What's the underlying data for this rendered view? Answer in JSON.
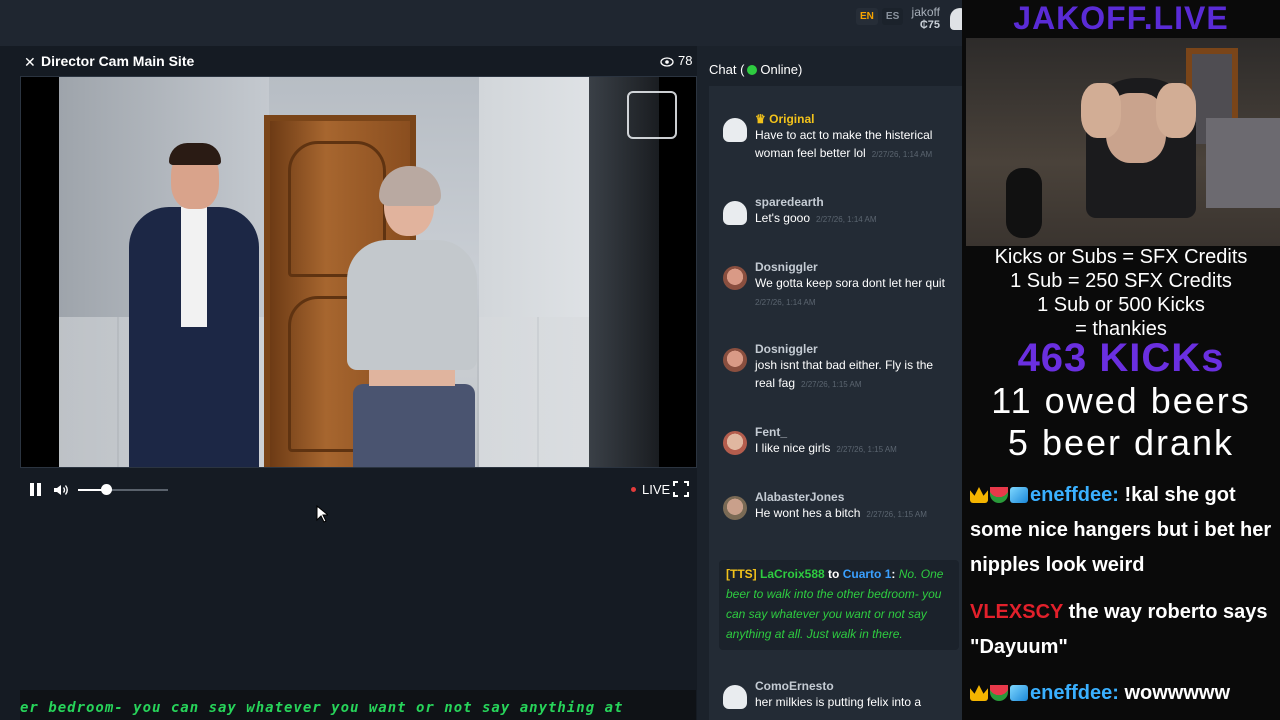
{
  "topbar": {
    "languages": [
      {
        "code": "EN",
        "active": true
      },
      {
        "code": "ES",
        "active": false
      }
    ],
    "user_name": "jakoff",
    "user_credits": "₵75"
  },
  "video": {
    "title": "Director Cam Main Site",
    "viewer_count": "78",
    "live_label": "LIVE",
    "volume_level": 0.3
  },
  "ticker_text": "er bedroom- you can say whatever you want or not say anything at",
  "chat": {
    "header_prefix": "Chat (",
    "status": "Online",
    "header_suffix": ")",
    "messages": [
      {
        "user": "Original",
        "text": "Have to act to make the histerical woman feel better lol",
        "time": "2/27/26, 1:14 AM",
        "crown": true
      },
      {
        "user": "sparedearth",
        "text": "Let's gooo",
        "time": "2/27/26, 1:14 AM"
      },
      {
        "user": "Dosniggler",
        "text": "We gotta keep sora dont let her quit",
        "time": "2/27/26, 1:14 AM"
      },
      {
        "user": "Dosniggler",
        "text": "josh isnt that bad either. Fly is the real fag",
        "time": "2/27/26, 1:15 AM"
      },
      {
        "user": "Fent_",
        "text": "I like nice girls",
        "time": "2/27/26, 1:15 AM"
      },
      {
        "user": "AlabasterJones",
        "text": "He wont hes a bitch",
        "time": "2/27/26, 1:15 AM"
      },
      {
        "user": "ComoErnesto",
        "text": "her milkies is putting felix into a",
        "time": ""
      }
    ],
    "tts": {
      "tag": "[TTS]",
      "from": "LaCroix588",
      "to_word": "to",
      "dest": "Cuarto 1",
      "message": "No. One beer to walk into the other bedroom- you can say whatever you want or not say anything at all. Just walk in there."
    }
  },
  "overlay": {
    "brand": "JAKOFF.LIVE",
    "lines": [
      "Kicks or Subs = SFX Credits",
      "1 Sub = 250 SFX Credits",
      "1 Sub or 500 Kicks",
      "= thankies"
    ],
    "kicks": "463 KICKs",
    "beers_owed": "11 owed beers",
    "beers_drank": "5 beer drank",
    "chat": [
      {
        "name": "eneffdee:",
        "text": "!kal she got some nice hangers but i bet her nipples look weird",
        "badges": true
      },
      {
        "name": "VLEXSCY",
        "text": "the way roberto says \"Dayuum\"",
        "badges": false
      },
      {
        "name": "eneffdee:",
        "text": "wowwwww",
        "badges": true
      }
    ]
  }
}
